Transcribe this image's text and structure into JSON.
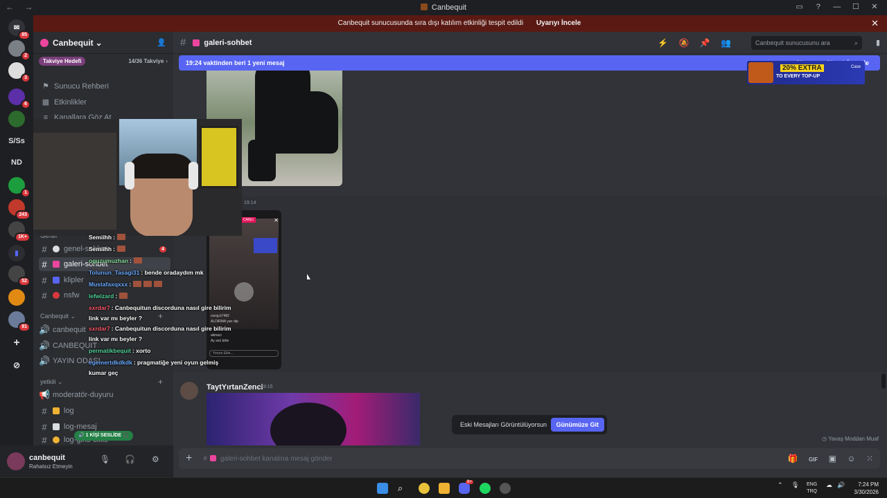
{
  "window": {
    "title": "Canbequit",
    "back_glyph": "←",
    "fwd_glyph": "→",
    "controls": [
      "▭",
      "?",
      "—",
      "☐",
      "✕"
    ]
  },
  "notice": {
    "text": "Canbequit sunucusunda sıra dışı katılım etkinliği tespit edildi",
    "button": "Uyarıyı İncele",
    "close": "✕"
  },
  "rail": {
    "badges": [
      "85",
      "2",
      "3",
      "6",
      "1",
      "243",
      "1K+",
      "52",
      "91"
    ],
    "text_servers": [
      "S/Ss",
      "ND"
    ],
    "add_glyph": "+",
    "explore_glyph": "⊘"
  },
  "sidebar": {
    "server_name": "Canbequit",
    "chevron": "⌄",
    "invite_glyph": "👤",
    "boost_label": "Takviye Hedefi",
    "boost_progress": "14/36 Takviye",
    "boost_arrow": "›",
    "nav": [
      {
        "glyph": "⚑",
        "label": "Sunucu Rehberi"
      },
      {
        "glyph": "▦",
        "label": "Etkinlikler"
      },
      {
        "glyph": "≡",
        "label": "Kanallara Göz At"
      }
    ],
    "category_genel": "Genel",
    "channels_genel": [
      {
        "name": "genel-sohbet",
        "emoji_color": "#dbdee1"
      },
      {
        "name": "galeri-sohbet",
        "emoji_color": "#eb459e"
      },
      {
        "name": "klipler",
        "emoji_color": "#5865f2"
      },
      {
        "name": "nsfw",
        "emoji_color": "#da373c"
      }
    ],
    "unread_count": "4",
    "category_canbequit": "Canbequit ⌄",
    "channels_canbequit": [
      {
        "name": "canbequit",
        "icon": "🔊"
      },
      {
        "name": "CANBEQUIT",
        "icon": "🔊"
      },
      {
        "name": "YAYIN ODASI",
        "icon": "🔊"
      }
    ],
    "category_yetkili": "yetkili ⌄",
    "channels_yetkili": [
      {
        "name": "moderatör-duyuru",
        "icon": "📢"
      },
      {
        "name": "log",
        "icon": "#"
      },
      {
        "name": "log-mesaj",
        "icon": "#"
      },
      {
        "name": "log-giris-cikis",
        "icon": "#"
      }
    ],
    "add_glyph": "+"
  },
  "voice_badge": "🔊 1 KİŞİ SESLİDE 🎧",
  "user": {
    "name": "canbequit",
    "status": "Rahatsız Etmeyin",
    "mic_glyph": "🎙",
    "headset_glyph": "🎧",
    "gear_glyph": "⚙"
  },
  "chat": {
    "channel_hash": "#",
    "channel_name": "galeri-sohbet",
    "tool_glyphs": [
      "⚡",
      "🔕",
      "📌",
      "👥"
    ],
    "search_placeholder": "Canbequit sunucusunu ara",
    "search_glyph": "⌕",
    "inbox_glyph": "▮",
    "new_messages": "19:24 vaktinden beri 1 yeni mesaj",
    "mark_read": "Okunmuş Olarak İşaretle",
    "ad": {
      "headline": "20% EXTRA",
      "sub": "TO EVERY TOP-UP",
      "brand": "Case"
    },
    "first_time": "19:14",
    "phone": {
      "live_label": "CANLI",
      "close": "✕",
      "comments": [
        "cwog.b7482",
        "ALDIRMA yarı dip",
        "akinaci",
        "Ay əzü böte"
      ],
      "input": "Yorum Ekle..."
    },
    "second_author": "TaytYırtanZenci",
    "second_time": "19:15",
    "jump_text": "Eski Mesajları Görüntülüyorsun",
    "jump_button": "Günümüze Git",
    "slowmode": "Yavaş Moddan Muaf",
    "composer_plus": "+",
    "composer_placeholder": "galeri-sohbet kanalına mesaj gönder",
    "composer_tools": [
      "🎁",
      "GIF",
      "▣",
      "☺",
      "⁙"
    ]
  },
  "stream_chat": [
    {
      "user": "Semiihh",
      "color": "#ffffff",
      "text": ":",
      "emotes": 1
    },
    {
      "user": "Semiihh",
      "color": "#ffffff",
      "text": ":",
      "emotes": 1
    },
    {
      "user": "oguzumuzhan",
      "color": "#8be0a1",
      "text": ":",
      "emotes": 1
    },
    {
      "user": "Tolunun_Tasagi31",
      "color": "#6aa9ff",
      "text": ": bende oradaydım mk",
      "emotes": 0
    },
    {
      "user": "Mustafaxqxxx",
      "color": "#6aa9ff",
      "text": ":",
      "emotes": 3
    },
    {
      "user": "lefwizard",
      "color": "#52d39a",
      "text": ":",
      "emotes": 1
    },
    {
      "user": "sxrdar7",
      "color": "#ff5b6a",
      "text": ": Canbequitun discorduna nasıl gire bilirim",
      "emotes": 0
    },
    {
      "user": "",
      "color": "#ffffff",
      "text": "link var mı beyler ?",
      "emotes": 0
    },
    {
      "user": "sxrdar7",
      "color": "#ff5b6a",
      "text": ": Canbequitun discorduna nasıl gire bilirim",
      "emotes": 0
    },
    {
      "user": "",
      "color": "#ffffff",
      "text": "link var mı beyler ?",
      "emotes": 0
    },
    {
      "user": "permatikbequit",
      "color": "#52d39a",
      "text": ": xorto",
      "emotes": 0
    },
    {
      "user": "egemertdkdkdk",
      "color": "#6aa9ff",
      "text": ": pragmatiğe yeni oyun gelmiş",
      "emotes": 0
    },
    {
      "user": "",
      "color": "#ffffff",
      "text": "kumar geç",
      "emotes": 0
    }
  ],
  "taskbar": {
    "lang": "ENG",
    "lang2": "TRQ",
    "time": "7:24 PM",
    "date": "3/30/2026",
    "discord_badge": "9+",
    "tray_arrow": "⌃",
    "tray_mic": "🎙",
    "tray_net": "☁",
    "tray_vol": "🔊"
  }
}
